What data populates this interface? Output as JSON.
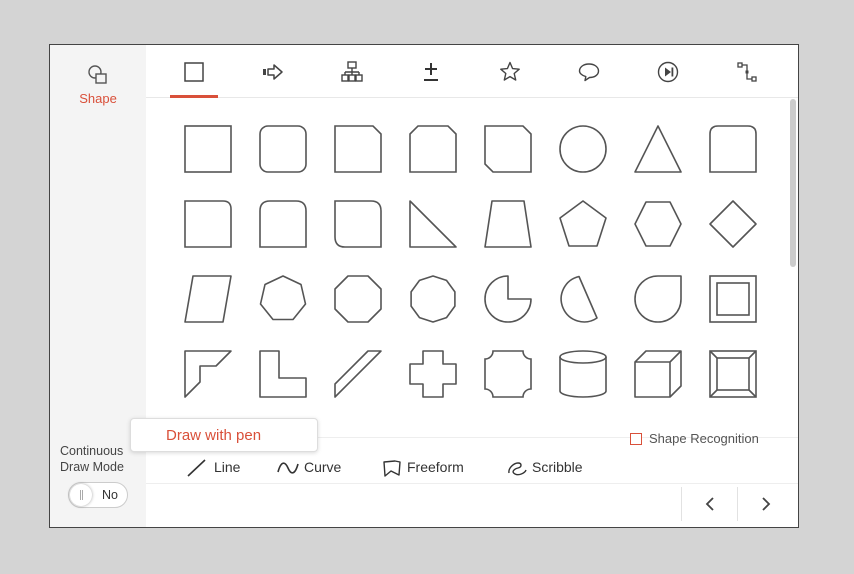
{
  "sidebar": {
    "shape_nav": {
      "label": "Shape",
      "icon": "shapes-icon"
    },
    "continuous_draw": {
      "label": "Continuous Draw Mode",
      "toggle_value": "No"
    }
  },
  "tabs": [
    {
      "icon": "square-icon",
      "active": true
    },
    {
      "icon": "arrow-icon",
      "active": false
    },
    {
      "icon": "flowchart-icon",
      "active": false
    },
    {
      "icon": "math-icon",
      "active": false
    },
    {
      "icon": "star-icon",
      "active": false
    },
    {
      "icon": "callout-icon",
      "active": false
    },
    {
      "icon": "action-button-icon",
      "active": false
    },
    {
      "icon": "connector-icon",
      "active": false
    }
  ],
  "gallery": {
    "shapes": [
      "rectangle",
      "rounded-rectangle",
      "snip-one-corner-rectangle",
      "snip-same-side-rectangle",
      "snip-diagonal-rectangle",
      "oval",
      "triangle",
      "round-same-side-rectangle",
      "round-one-corner-rectangle",
      "round-top-rectangle",
      "round-diagonal-rectangle",
      "right-triangle",
      "trapezoid",
      "pentagon",
      "hexagon",
      "diamond",
      "parallelogram",
      "heptagon",
      "octagon",
      "decagon",
      "pie",
      "chord",
      "teardrop",
      "frame",
      "half-frame",
      "l-shape",
      "diagonal-stripe",
      "cross",
      "plaque",
      "can",
      "cube",
      "bevel"
    ]
  },
  "shape_recognition": {
    "label": "Shape Recognition",
    "checked": false
  },
  "tooltip": {
    "text": "Draw with pen"
  },
  "pen_tools": [
    {
      "label": "Line",
      "icon": "line-icon"
    },
    {
      "label": "Curve",
      "icon": "curve-icon"
    },
    {
      "label": "Freeform",
      "icon": "freeform-icon"
    },
    {
      "label": "Scribble",
      "icon": "scribble-icon"
    }
  ],
  "footer": {
    "prev_icon": "chevron-left-icon",
    "next_icon": "chevron-right-icon"
  },
  "colors": {
    "accent": "#d9503a",
    "stroke": "#555555",
    "sidebar_bg": "#f4f4f4"
  }
}
